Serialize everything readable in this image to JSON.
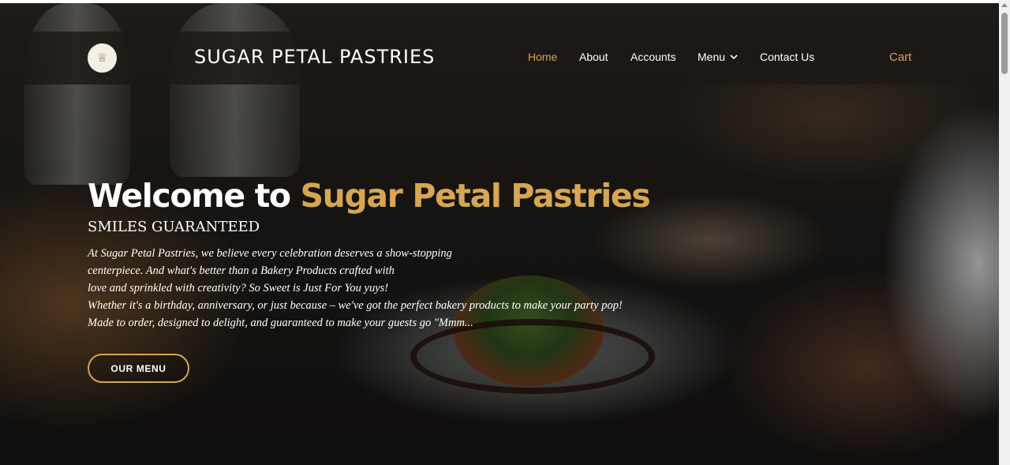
{
  "brand": {
    "logo_icon": "cake-stand-icon",
    "name": "SUGAR PETAL PASTRIES"
  },
  "nav": {
    "items": [
      {
        "label": "Home",
        "active": true
      },
      {
        "label": "About"
      },
      {
        "label": "Accounts"
      },
      {
        "label": "Menu",
        "has_dropdown": true
      },
      {
        "label": "Contact Us"
      }
    ],
    "cart_label": "Cart"
  },
  "hero": {
    "headline_prefix": "Welcome to",
    "headline_accent": "Sugar Petal Pastries",
    "tagline": "SMILES GUARANTEED",
    "intro_lines": [
      "At Sugar Petal Pastries, we believe every celebration deserves a show-stopping",
      "centerpiece. And what's better than a Bakery Products crafted with",
      "love and sprinkled with creativity? So Sweet is Just For You yuys!",
      "Whether it's a birthday, anniversary, or just because – we've got the perfect bakery products to make your party pop!",
      "Made to order, designed to delight, and guaranteed to make your guests go \"Mmm..."
    ],
    "cta_label": "OUR MENU"
  },
  "colors": {
    "accent": "#d6a652",
    "navbar_bg": "#1c1815",
    "text": "#ffffff"
  }
}
